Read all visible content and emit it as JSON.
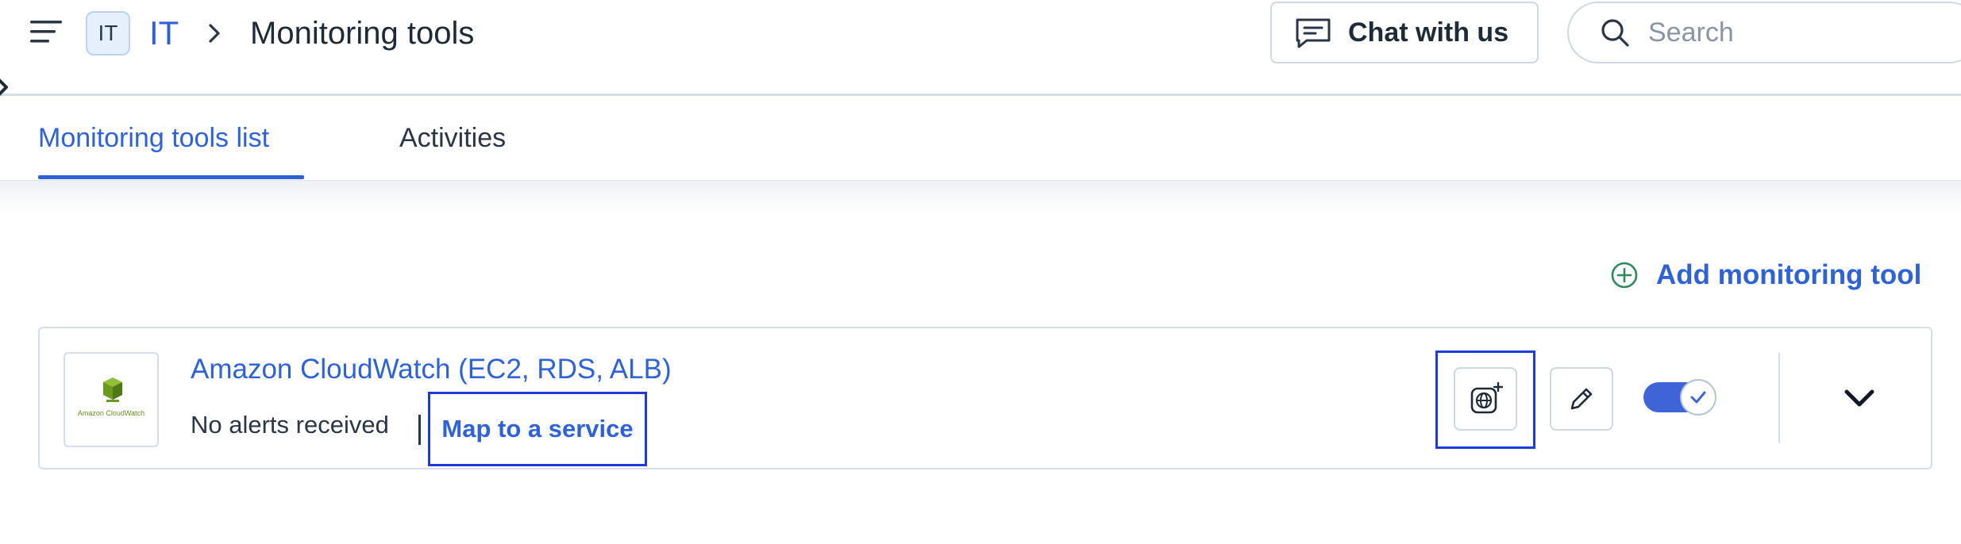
{
  "header": {
    "workspace_badge": "IT",
    "workspace_name": "IT",
    "page_title": "Monitoring tools",
    "chat_label": "Chat with us",
    "search_placeholder": "Search"
  },
  "tabs": [
    {
      "label": "Monitoring tools list",
      "active": true
    },
    {
      "label": "Activities",
      "active": false
    }
  ],
  "actions": {
    "add_tool_label": "Add monitoring tool"
  },
  "tools": [
    {
      "name": "Amazon CloudWatch (EC2, RDS, ALB)",
      "logo_caption": "Amazon CloudWatch",
      "status": "No alerts received",
      "map_link": "Map to a service",
      "enabled": true
    }
  ],
  "icons": {
    "menu": "hamburger-menu-icon",
    "breadcrumb": "chevron-right-icon",
    "chat": "chat-bubble-icon",
    "search": "magnifier-icon",
    "add": "plus-circle-icon",
    "map_service": "globe-plus-icon",
    "edit": "pencil-icon",
    "toggle": "check-icon",
    "expand": "chevron-down-icon"
  },
  "colors": {
    "accent": "#2f62d6",
    "highlight_frame": "#1f3ad6",
    "toggle_on": "#3f64d8",
    "add_icon": "#2e8a5e"
  }
}
